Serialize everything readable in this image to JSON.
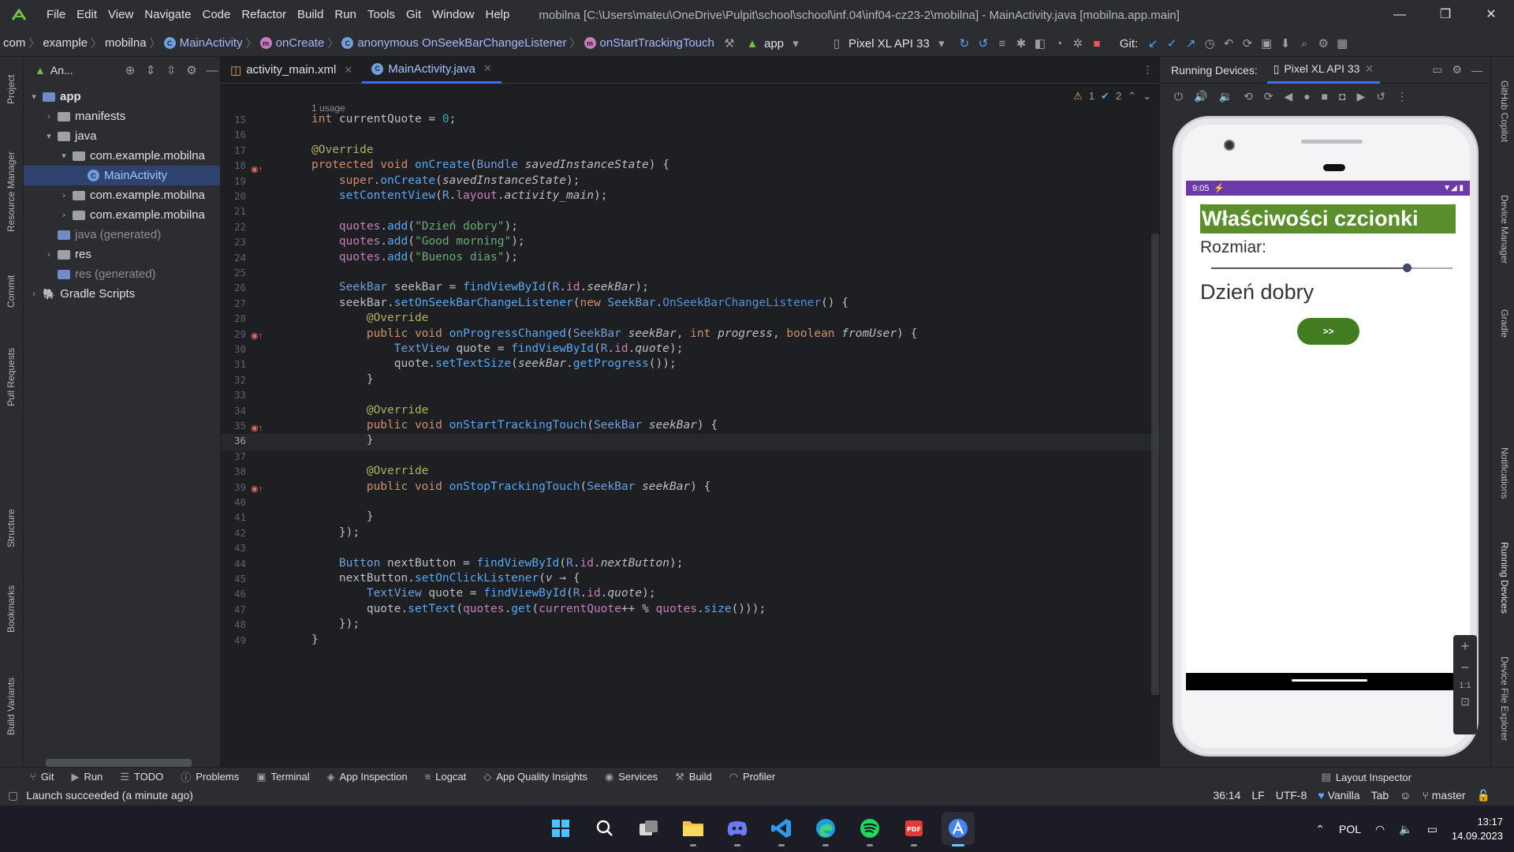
{
  "titlebar": {
    "menu": [
      "File",
      "Edit",
      "View",
      "Navigate",
      "Code",
      "Refactor",
      "Build",
      "Run",
      "Tools",
      "Git",
      "Window",
      "Help"
    ],
    "title": "mobilna [C:\\Users\\mateu\\OneDrive\\Pulpit\\school\\school\\inf.04\\inf04-cz23-2\\mobilna] - MainActivity.java [mobilna.app.main]"
  },
  "breadcrumbs": [
    "com",
    "example",
    "mobilna",
    "MainActivity",
    "onCreate",
    "anonymous OnSeekBarChangeListener",
    "onStartTrackingTouch"
  ],
  "toolbar": {
    "run_config": "app",
    "device": "Pixel XL API 33",
    "git_label": "Git:"
  },
  "project_panel": {
    "title": "An...",
    "tree": [
      {
        "label": "app",
        "indent": 0,
        "chevron": "▾",
        "kind": "module"
      },
      {
        "label": "manifests",
        "indent": 1,
        "chevron": "›",
        "kind": "folder"
      },
      {
        "label": "java",
        "indent": 1,
        "chevron": "▾",
        "kind": "folder"
      },
      {
        "label": "com.example.mobilna",
        "indent": 2,
        "chevron": "▾",
        "kind": "package"
      },
      {
        "label": "MainActivity",
        "indent": 3,
        "chevron": "",
        "kind": "class",
        "selected": true
      },
      {
        "label": "com.example.mobilna",
        "indent": 2,
        "chevron": "›",
        "kind": "package"
      },
      {
        "label": "com.example.mobilna",
        "indent": 2,
        "chevron": "›",
        "kind": "package"
      },
      {
        "label": "java (generated)",
        "indent": 1,
        "chevron": "",
        "kind": "generated"
      },
      {
        "label": "res",
        "indent": 1,
        "chevron": "›",
        "kind": "folder"
      },
      {
        "label": "res (generated)",
        "indent": 1,
        "chevron": "",
        "kind": "generated"
      },
      {
        "label": "Gradle Scripts",
        "indent": 0,
        "chevron": "›",
        "kind": "gradle"
      }
    ]
  },
  "left_strip": [
    "Project",
    "Resource Manager",
    "Commit",
    "Pull Requests",
    "Structure",
    "Bookmarks",
    "Build Variants"
  ],
  "right_strip": [
    "GitHub Copilot",
    "Device Manager",
    "Gradle",
    "Notifications",
    "Running Devices",
    "Device File Explorer"
  ],
  "editor": {
    "tabs": [
      {
        "label": "activity_main.xml",
        "active": false
      },
      {
        "label": "MainActivity.java",
        "active": true
      }
    ],
    "usage_hint": "1 usage",
    "inspections": {
      "warnings": "1",
      "weak": "2"
    },
    "current_line": "36",
    "lines": [
      {
        "n": "15",
        "html": "<span class='kw'>int</span> currentQuote = <span class='num'>0</span>;"
      },
      {
        "n": "16",
        "html": ""
      },
      {
        "n": "17",
        "html": "<span class='ann'>@Override</span>"
      },
      {
        "n": "18",
        "html": "<span class='kw'>protected void</span> <span class='fn'>onCreate</span>(<span class='cls'>Bundle</span> <span class='par'>savedInstanceState</span>) {"
      },
      {
        "n": "19",
        "html": "    <span class='kw'>super</span>.<span class='fn'>onCreate</span>(<span class='par'>savedInstanceState</span>);"
      },
      {
        "n": "20",
        "html": "    <span class='fn'>setContentView</span>(<span class='cls'>R</span>.<span class='fld'>layout</span>.<span class='par'>activity_main</span>);"
      },
      {
        "n": "21",
        "html": ""
      },
      {
        "n": "22",
        "html": "    <span class='fld'>quotes</span>.<span class='fn'>add</span>(<span class='str'>\"Dzień dobry\"</span>);"
      },
      {
        "n": "23",
        "html": "    <span class='fld'>quotes</span>.<span class='fn'>add</span>(<span class='str'>\"Good morning\"</span>);"
      },
      {
        "n": "24",
        "html": "    <span class='fld'>quotes</span>.<span class='fn'>add</span>(<span class='str'>\"Buenos dias\"</span>);"
      },
      {
        "n": "25",
        "html": ""
      },
      {
        "n": "26",
        "html": "    <span class='cls'>SeekBar</span> seekBar = <span class='fn'>findViewById</span>(<span class='cls'>R</span>.<span class='fld'>id</span>.<span class='par'>seekBar</span>);"
      },
      {
        "n": "27",
        "html": "    seekBar.<span class='fn'>setOnSeekBarChangeListener</span>(<span class='kw'>new</span> <span class='cls'>SeekBar</span>.<span class='typ'>OnSeekBarChangeListener</span>() {"
      },
      {
        "n": "28",
        "html": "        <span class='ann'>@Override</span>"
      },
      {
        "n": "29",
        "html": "        <span class='kw'>public void</span> <span class='fn'>onProgressChanged</span>(<span class='cls'>SeekBar</span> <span class='par'>seekBar</span>, <span class='kw'>int</span> <span class='par'>progress</span>, <span class='kw'>boolean</span> <span class='par'>fromUser</span>) {"
      },
      {
        "n": "30",
        "html": "            <span class='cls'>TextView</span> quote = <span class='fn'>findViewById</span>(<span class='cls'>R</span>.<span class='fld'>id</span>.<span class='par'>quote</span>);"
      },
      {
        "n": "31",
        "html": "            quote.<span class='fn'>setTextSize</span>(<span class='par'>seekBar</span>.<span class='fn'>getProgress</span>());"
      },
      {
        "n": "32",
        "html": "        }"
      },
      {
        "n": "33",
        "html": ""
      },
      {
        "n": "34",
        "html": "        <span class='ann'>@Override</span>"
      },
      {
        "n": "35",
        "html": "        <span class='kw'>public void</span> <span class='fn'>onStartTrackingTouch</span>(<span class='cls'>SeekBar</span> <span class='par'>seekBar</span>) {"
      },
      {
        "n": "36",
        "html": "        }"
      },
      {
        "n": "37",
        "html": ""
      },
      {
        "n": "38",
        "html": "        <span class='ann'>@Override</span>"
      },
      {
        "n": "39",
        "html": "        <span class='kw'>public void</span> <span class='fn'>onStopTrackingTouch</span>(<span class='cls'>SeekBar</span> <span class='par'>seekBar</span>) {"
      },
      {
        "n": "40",
        "html": ""
      },
      {
        "n": "41",
        "html": "        }"
      },
      {
        "n": "42",
        "html": "    });"
      },
      {
        "n": "43",
        "html": ""
      },
      {
        "n": "44",
        "html": "    <span class='cls'>Button</span> nextButton = <span class='fn'>findViewById</span>(<span class='cls'>R</span>.<span class='fld'>id</span>.<span class='par'>nextButton</span>);"
      },
      {
        "n": "45",
        "html": "    nextButton.<span class='fn'>setOnClickListener</span>(<span class='par'>v</span> → {"
      },
      {
        "n": "46",
        "html": "        <span class='cls'>TextView</span> quote = <span class='fn'>findViewById</span>(<span class='cls'>R</span>.<span class='fld'>id</span>.<span class='par'>quote</span>);"
      },
      {
        "n": "47",
        "html": "        quote.<span class='fn'>setText</span>(<span class='fld'>quotes</span>.<span class='fn'>get</span>(<span class='fld'>currentQuote</span>++ % <span class='fld'>quotes</span>.<span class='fn'>size</span>()));"
      },
      {
        "n": "48",
        "html": "    });"
      },
      {
        "n": "49",
        "html": "}"
      }
    ]
  },
  "devices_panel": {
    "label": "Running Devices:",
    "device_tab": "Pixel XL API 33",
    "zoom_ratio": "1:1"
  },
  "phone_app": {
    "status_time": "9:05",
    "title": "Właściwości czcionki",
    "size_label": "Rozmiar:",
    "seekbar_progress": 0.81,
    "quote": "Dzień dobry",
    "next_button": ">>",
    "title_color": "#5a8f2c",
    "button_color": "#3f7d20",
    "status_color": "#6c3aa8"
  },
  "bottom_toolwindows": [
    "Git",
    "Run",
    "TODO",
    "Problems",
    "Terminal",
    "App Inspection",
    "Logcat",
    "App Quality Insights",
    "Services",
    "Build",
    "Profiler"
  ],
  "layout_inspector": "Layout Inspector",
  "statusbar": {
    "message": "Launch succeeded (a minute ago)",
    "position": "36:14",
    "line_sep": "LF",
    "encoding": "UTF-8",
    "theme": "Vanilla",
    "indent": "Tab",
    "branch": "master"
  },
  "taskbar": {
    "apps": [
      "start-icon",
      "search-icon",
      "task-view-icon",
      "file-explorer-icon",
      "discord-icon",
      "vscode-icon",
      "edge-icon",
      "spotify-icon",
      "pdf-icon",
      "android-studio-icon"
    ],
    "lang": "POL",
    "time": "13:17",
    "date": "14.09.2023"
  }
}
